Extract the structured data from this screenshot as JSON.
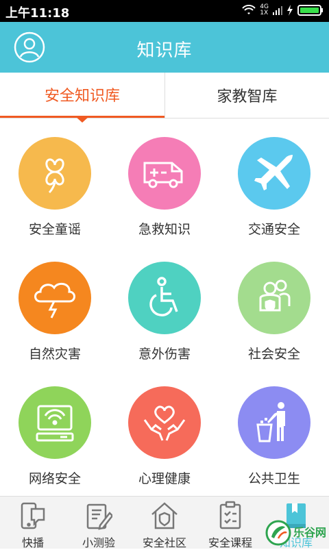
{
  "status": {
    "time": "上午11:18",
    "network": "4G",
    "network_sub": "1X"
  },
  "header": {
    "title": "知识库",
    "avatar_icon": "user-avatar-icon"
  },
  "tabs": [
    {
      "label": "安全知识库",
      "active": true
    },
    {
      "label": "家教智库",
      "active": false
    }
  ],
  "categories": [
    {
      "label": "安全童谣",
      "color": "#f6b94d",
      "icon": "clover-icon"
    },
    {
      "label": "急救知识",
      "color": "#f57db6",
      "icon": "ambulance-icon"
    },
    {
      "label": "交通安全",
      "color": "#5bc9ee",
      "icon": "airplane-icon"
    },
    {
      "label": "自然灾害",
      "color": "#f5871f",
      "icon": "storm-cloud-icon"
    },
    {
      "label": "意外伤害",
      "color": "#4fd1c1",
      "icon": "wheelchair-icon"
    },
    {
      "label": "社会安全",
      "color": "#a3dc8e",
      "icon": "family-shield-icon"
    },
    {
      "label": "网络安全",
      "color": "#8fd45a",
      "icon": "computer-wifi-icon"
    },
    {
      "label": "心理健康",
      "color": "#f66b5a",
      "icon": "heart-hands-icon"
    },
    {
      "label": "公共卫生",
      "color": "#8c8cf2",
      "icon": "trash-person-icon"
    }
  ],
  "bottom_nav": [
    {
      "label": "快播",
      "icon": "phone-chat-icon",
      "active": false
    },
    {
      "label": "小测验",
      "icon": "edit-quiz-icon",
      "active": false
    },
    {
      "label": "安全社区",
      "icon": "house-shield-icon",
      "active": false
    },
    {
      "label": "安全课程",
      "icon": "clipboard-course-icon",
      "active": false
    },
    {
      "label": "知识库",
      "icon": "book-icon",
      "active": true
    }
  ],
  "watermark": {
    "text": "乐谷网"
  }
}
